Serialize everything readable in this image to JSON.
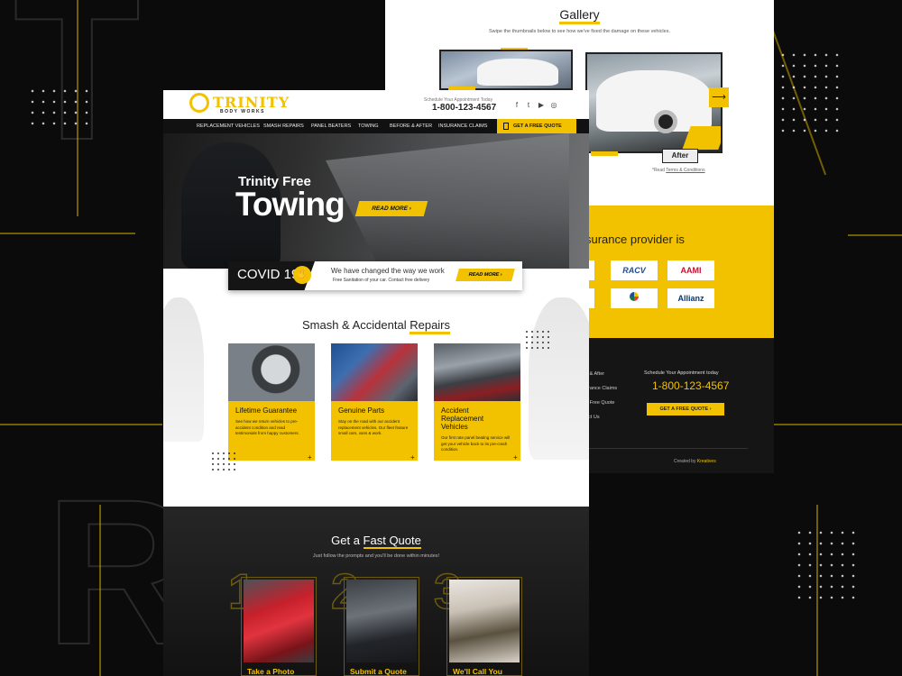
{
  "colors": {
    "accent": "#f2c200",
    "dark": "#111111",
    "white": "#ffffff"
  },
  "gallery": {
    "title": "Gallery",
    "subtitle": "Swipe the thumbnails below to see how we've fixed the damage on these vehicles.",
    "after_label": "After",
    "next_icon": "arrow-right-icon",
    "terms_prefix": "*Read",
    "terms_link": "Terms & Conditions"
  },
  "insurers": {
    "title": "surance provider is",
    "logos": [
      "O",
      "RACV",
      "AAMI",
      "",
      "Suncorp",
      "Allianz"
    ]
  },
  "footer": {
    "links": [
      "e & After",
      "urance Claims",
      "a Free Quote",
      "act Us"
    ],
    "schedule": "Schedule Your Appointment today",
    "phone": "1-800-123-4567",
    "quote_button": "GET A FREE QUOTE",
    "credit_prefix": "Created by",
    "credit_name": "Kreatives"
  },
  "header": {
    "brand": "TRINITY",
    "brand_sub": "BODY WORKS",
    "schedule": "Schedule Your Appointment Today",
    "phone": "1-800-123-4567",
    "social": [
      "facebook-icon",
      "twitter-icon",
      "youtube-icon",
      "instagram-icon"
    ]
  },
  "nav": {
    "items": [
      "REPLACEMENT VEHICLES",
      "SMASH REPAIRS",
      "PANEL BEATERS",
      "TOWING",
      "BEFORE & AFTER",
      "INSURANCE CLAIMS"
    ],
    "quote_button": "GET A FREE QUOTE"
  },
  "hero": {
    "line1": "Trinity Free",
    "line2": "Towing",
    "button": "READ MORE"
  },
  "covid": {
    "label": "COVID 19",
    "message": "We have changed the way we work",
    "detail": "Free Sanitation of your car. Contact free delivery",
    "button": "READ MORE"
  },
  "repairs": {
    "title_prefix": "Smash & Accidental",
    "title_highlight": "Repairs",
    "cards": [
      {
        "title": "Lifetime Guarantee",
        "desc": "See how we return vehicles to pre-accident condition and read testimonials from happy customers."
      },
      {
        "title": "Genuine Parts",
        "desc": "Stay on the road with our accident replacement vehicles. Our fleet feature small cars, vans & work."
      },
      {
        "title": "Accident Replacement Vehicles",
        "desc": "Our first rate panel beating service will get your vehicle back to its pre-crash condition."
      }
    ]
  },
  "fast_quote": {
    "title_prefix": "Get a",
    "title_highlight": "Fast Quote",
    "subtitle": "Just follow the prompts and you'll be done within minutes!",
    "steps": [
      {
        "num": "1",
        "label": "Take a Photo"
      },
      {
        "num": "2",
        "label": "Submit a Quote"
      },
      {
        "num": "3",
        "label": "We'll Call You"
      }
    ]
  }
}
